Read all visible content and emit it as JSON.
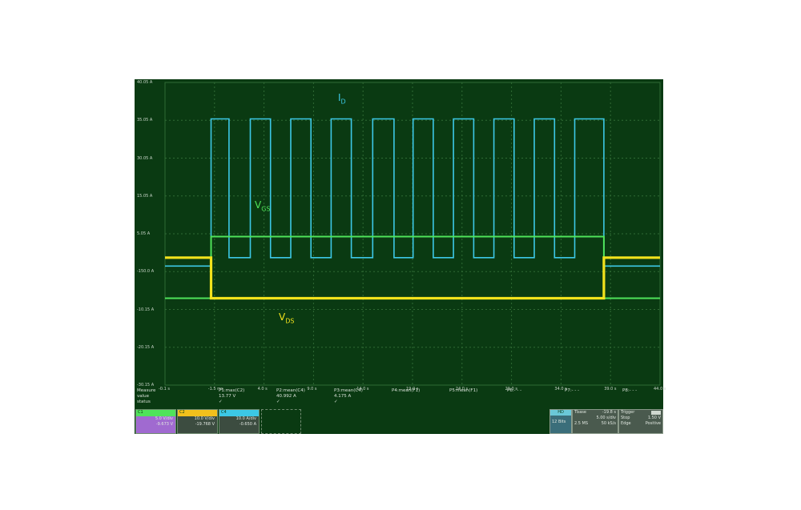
{
  "colors": {
    "background": "#0a3a12",
    "grid": "#2f6a34",
    "id_trace": "#3cc8e6",
    "vgs_trace": "#4fe35a",
    "vds_trace": "#f2e21c"
  },
  "labels": {
    "id": {
      "main": "I",
      "sub": "D"
    },
    "vgs": {
      "main": "V",
      "sub": "GS"
    },
    "vds": {
      "main": "V",
      "sub": "DS"
    }
  },
  "chart_data": {
    "type": "line",
    "x_ticks": [
      "-0.1 s",
      "-1.5 ms",
      "4.0 s",
      "9.0 s",
      "14.0 s",
      "19.0 s",
      "24.0 s",
      "29.0 s",
      "34.0 s",
      "39.0 s",
      "44.0 s"
    ],
    "y_ticks": [
      "40.05 A",
      "35.05 A",
      "30.05 A",
      "15.05 A",
      "5.05 A",
      "-150.0 A",
      "-10.15 A",
      "-20.15 A",
      "-30.15 A"
    ],
    "ylim": [
      -4.5,
      6.3
    ],
    "xlim": [
      -0.1,
      44.0
    ],
    "grid": true,
    "series": [
      {
        "name": "I",
        "color": "#3cc8e6",
        "x": [
          -0.1,
          4.0,
          4.0,
          5.6,
          5.6,
          7.5,
          7.5,
          9.3,
          9.3,
          11.1,
          11.1,
          12.9,
          12.9,
          14.7,
          14.7,
          16.5,
          16.5,
          18.4,
          18.4,
          20.3,
          20.3,
          22.0,
          22.0,
          23.8,
          23.8,
          25.6,
          25.6,
          27.4,
          27.4,
          29.2,
          29.2,
          31.0,
          31.0,
          32.8,
          32.8,
          34.6,
          34.6,
          36.4,
          36.4,
          39.0,
          39.0,
          44.0
        ],
        "y": [
          -0.25,
          -0.25,
          5.0,
          5.0,
          0.05,
          0.05,
          5.0,
          5.0,
          0.05,
          0.05,
          5.0,
          5.0,
          0.05,
          0.05,
          5.0,
          5.0,
          0.05,
          0.05,
          5.0,
          5.0,
          0.05,
          0.05,
          5.0,
          5.0,
          0.05,
          0.05,
          5.0,
          5.0,
          0.05,
          0.05,
          5.0,
          5.0,
          0.05,
          0.05,
          5.0,
          5.0,
          0.05,
          0.05,
          5.0,
          5.0,
          -0.25,
          -0.25
        ]
      },
      {
        "name": "V",
        "color": "#4fe35a",
        "x": [
          -0.1,
          4.0,
          4.0,
          39.0,
          39.0,
          44.0
        ],
        "y": [
          -1.4,
          -1.4,
          0.8,
          0.8,
          -1.4,
          -1.4
        ]
      },
      {
        "name": "V",
        "color": "#f2e21c",
        "x": [
          -0.1,
          4.0,
          4.0,
          39.0,
          39.0,
          44.0
        ],
        "y": [
          0.05,
          0.05,
          -1.4,
          -1.4,
          0.05,
          0.05
        ]
      }
    ]
  },
  "measure": {
    "header": "Measure",
    "row_labels": [
      "value",
      "status"
    ],
    "items": [
      {
        "name": "P1:max(C2)",
        "value": "13.77 V",
        "status": "✓"
      },
      {
        "name": "P2:mean(C4)",
        "value": "40.992 A",
        "status": "✓"
      },
      {
        "name": "P3:mean(C4)",
        "value": "4.175 A",
        "status": "✓"
      },
      {
        "name": "P4:mean(F1)",
        "value": "",
        "status": ""
      },
      {
        "name": "P5:mean(F1)",
        "value": "",
        "status": ""
      },
      {
        "name": "P6:- - -",
        "value": "",
        "status": ""
      },
      {
        "name": "P7:- - -",
        "value": "",
        "status": ""
      },
      {
        "name": "P8:- - -",
        "value": "",
        "status": ""
      }
    ]
  },
  "channels": [
    {
      "color": "#4fe35a",
      "hdr_text": "C1",
      "scale": "5.0 V/div",
      "offset": "-9.673 V",
      "bg": "#a06ad0"
    },
    {
      "color": "#f2c01c",
      "hdr_text": "C2",
      "scale": "10.0 V/div",
      "offset": "-19.768 V",
      "bg": "#3c4c40"
    },
    {
      "color": "#3cc8e6",
      "hdr_text": "C4",
      "scale": "10.0 A/div",
      "offset": "-0.650 A",
      "bg": "#3c4c40"
    }
  ],
  "timebase": {
    "hd_label": "HD",
    "bits": "12 Bits",
    "title": "Tbase",
    "delay": "-19.8 s",
    "per_div": "5.00 s/div",
    "samples": "2.5 MS",
    "rate": "50 kS/s"
  },
  "trigger": {
    "title": "Trigger",
    "mode": "Stop",
    "level": "1.50 V",
    "type": "Edge",
    "slope": "Positive"
  }
}
